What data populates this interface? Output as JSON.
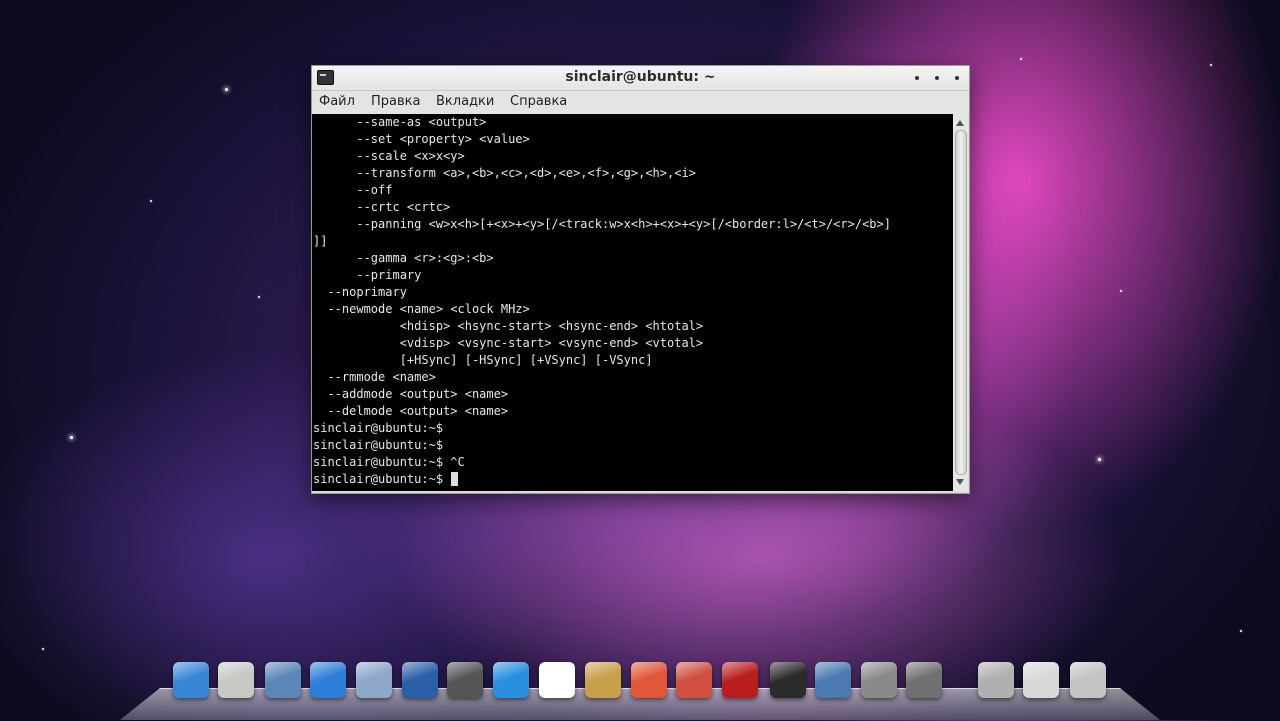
{
  "window": {
    "title": "sinclair@ubuntu: ~",
    "menu": [
      "Файл",
      "Правка",
      "Вкладки",
      "Справка"
    ]
  },
  "terminal": {
    "lines": [
      "      --same-as <output>",
      "      --set <property> <value>",
      "      --scale <x>x<y>",
      "      --transform <a>,<b>,<c>,<d>,<e>,<f>,<g>,<h>,<i>",
      "      --off",
      "      --crtc <crtc>",
      "      --panning <w>x<h>[+<x>+<y>[/<track:w>x<h>+<x>+<y>[/<border:l>/<t>/<r>/<b>]",
      "]]",
      "      --gamma <r>:<g>:<b>",
      "      --primary",
      "  --noprimary",
      "  --newmode <name> <clock MHz>",
      "            <hdisp> <hsync-start> <hsync-end> <htotal>",
      "            <vdisp> <vsync-start> <vsync-end> <vtotal>",
      "            [+HSync] [-HSync] [+VSync] [-VSync]",
      "  --rmmode <name>",
      "  --addmode <output> <name>",
      "  --delmode <output> <name>",
      "sinclair@ubuntu:~$",
      "sinclair@ubuntu:~$",
      "sinclair@ubuntu:~$ ^C",
      "sinclair@ubuntu:~$ "
    ]
  },
  "dock": {
    "icons": [
      {
        "name": "finder-icon",
        "color": "#3a86d6"
      },
      {
        "name": "calculator-icon",
        "color": "#c9c9c4"
      },
      {
        "name": "mail-stamp-icon",
        "color": "#5b86b8"
      },
      {
        "name": "safari-icon",
        "color": "#2f7fd8"
      },
      {
        "name": "photos-icon",
        "color": "#8fa7c8"
      },
      {
        "name": "video-clapper-icon",
        "color": "#2a5fa8"
      },
      {
        "name": "headphones-icon",
        "color": "#555555"
      },
      {
        "name": "itunes-icon",
        "color": "#2a8fe0"
      },
      {
        "name": "calendar-icon",
        "color": "#ffffff"
      },
      {
        "name": "photo-camera-icon",
        "color": "#c9a04a"
      },
      {
        "name": "media-player-icon",
        "color": "#e0583a"
      },
      {
        "name": "install-package-icon",
        "color": "#d05040"
      },
      {
        "name": "photo-booth-icon",
        "color": "#b81e1e"
      },
      {
        "name": "terminal-icon",
        "color": "#2b2b2b"
      },
      {
        "name": "activity-monitor-icon",
        "color": "#4a7ab0"
      },
      {
        "name": "system-preferences-icon",
        "color": "#8a8a8a"
      },
      {
        "name": "disk-drive-icon",
        "color": "#707070"
      },
      {
        "name": "hard-disk-icon",
        "color": "#b0b0b0"
      },
      {
        "name": "search-magnifier-icon",
        "color": "#d8d8d8"
      },
      {
        "name": "trash-icon",
        "color": "#c4c4c4"
      }
    ]
  }
}
